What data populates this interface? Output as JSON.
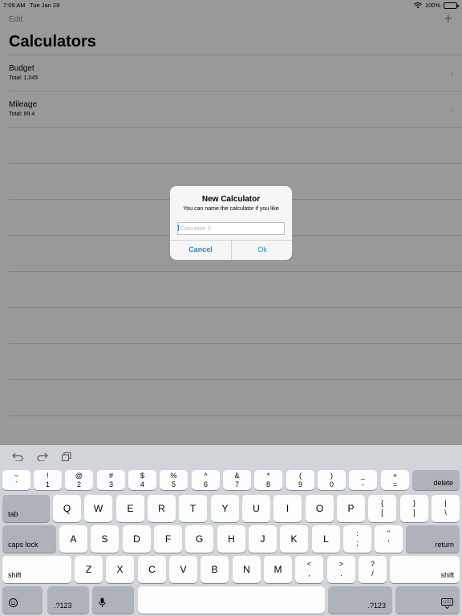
{
  "status_bar": {
    "time": "7:09 AM",
    "date": "Tue Jan 29",
    "battery": "100%"
  },
  "nav": {
    "edit_label": "Edit",
    "add_icon": "plus-icon"
  },
  "page": {
    "title": "Calculators"
  },
  "list": [
    {
      "title": "Budget",
      "subtitle": "Total: 1,045"
    },
    {
      "title": "Mileage",
      "subtitle": "Total: 89.4"
    }
  ],
  "alert": {
    "title": "New Calculator",
    "message": "You can name the calculator if you like",
    "input_placeholder": "Calculator 3",
    "input_value": "",
    "cancel_label": "Cancel",
    "ok_label": "Ok",
    "button_color": "#1a8fcd"
  },
  "keyboard": {
    "toolbar": [
      "undo-icon",
      "redo-icon",
      "paste-icon"
    ],
    "number_row": [
      {
        "top": "~",
        "bottom": "`"
      },
      {
        "top": "!",
        "bottom": "1"
      },
      {
        "top": "@",
        "bottom": "2"
      },
      {
        "top": "#",
        "bottom": "3"
      },
      {
        "top": "$",
        "bottom": "4"
      },
      {
        "top": "%",
        "bottom": "5"
      },
      {
        "top": "^",
        "bottom": "6"
      },
      {
        "top": "&",
        "bottom": "7"
      },
      {
        "top": "*",
        "bottom": "8"
      },
      {
        "top": "(",
        "bottom": "9"
      },
      {
        "top": ")",
        "bottom": "0"
      },
      {
        "top": "_",
        "bottom": "-"
      },
      {
        "top": "+",
        "bottom": "="
      }
    ],
    "delete_label": "delete",
    "tab_label": "tab",
    "row1": [
      "Q",
      "W",
      "E",
      "R",
      "T",
      "Y",
      "U",
      "I",
      "O",
      "P"
    ],
    "row1_symbols": [
      {
        "top": "{",
        "bottom": "["
      },
      {
        "top": "}",
        "bottom": "]"
      },
      {
        "top": "|",
        "bottom": "\\"
      }
    ],
    "caps_lock_label": "caps lock",
    "row2": [
      "A",
      "S",
      "D",
      "F",
      "G",
      "H",
      "J",
      "K",
      "L"
    ],
    "row2_symbols": [
      {
        "top": ":",
        "bottom": ";"
      },
      {
        "top": "\"",
        "bottom": "'"
      }
    ],
    "return_label": "return",
    "shift_label": "shift",
    "row3": [
      "Z",
      "X",
      "C",
      "V",
      "B",
      "N",
      "M"
    ],
    "row3_symbols": [
      {
        "top": "<",
        "bottom": ","
      },
      {
        "top": ">",
        "bottom": "."
      },
      {
        "top": "?",
        "bottom": "/"
      }
    ],
    "numbers_label": ".?123",
    "emoji_icon": "emoji-icon",
    "mic_icon": "microphone-icon",
    "dismiss_icon": "keyboard-dismiss-icon"
  }
}
